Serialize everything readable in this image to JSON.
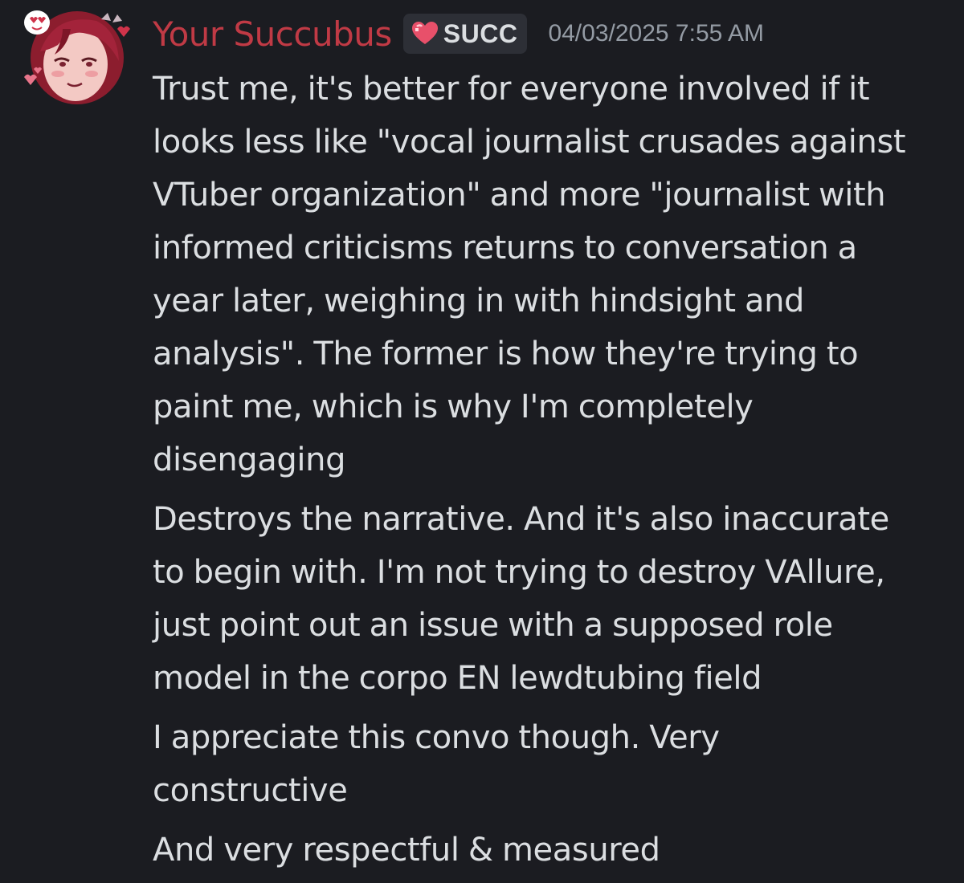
{
  "message": {
    "author": "Your Succubus",
    "author_color": "#c03a45",
    "tag": {
      "icon": "heart-icon",
      "label": "SUCC"
    },
    "timestamp": "04/03/2025 7:55 AM",
    "avatar": "avatar-icon",
    "paragraphs": [
      [
        "Trust me, it's better for everyone involved if it",
        "looks less like \"vocal journalist crusades against",
        "VTuber organization\" and more \"journalist with",
        "informed criticisms returns to conversation a",
        "year later, weighing in with hindsight and",
        "analysis\". The former is how they're trying to",
        "paint me, which is why I'm completely",
        "disengaging"
      ],
      [
        "Destroys the narrative. And it's also inaccurate",
        "to begin with. I'm not trying to destroy VAllure,",
        "just point out an issue with a supposed role",
        "model in the corpo EN lewdtubing field"
      ],
      [
        "I appreciate this convo though. Very",
        "constructive"
      ],
      [
        "And very respectful & measured"
      ]
    ]
  }
}
